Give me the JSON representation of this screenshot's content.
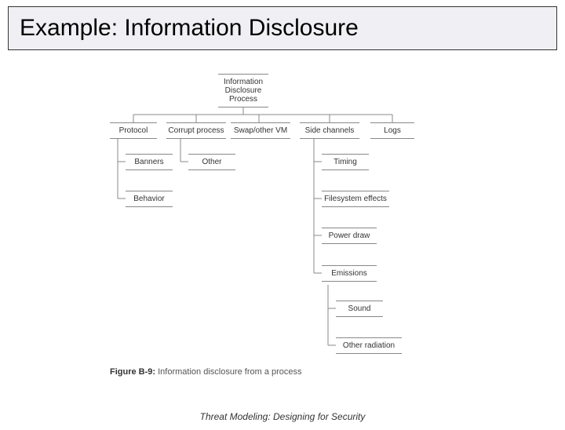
{
  "title": "Example: Information Disclosure",
  "footer": "Threat Modeling: Designing for Security",
  "caption_prefix": "Figure B-9:",
  "caption_text": " Information disclosure from a process",
  "nodes": {
    "root": "Information\nDisclosure\nProcess",
    "protocol": "Protocol",
    "corrupt": "Corrupt process",
    "swap": "Swap/other VM",
    "side": "Side channels",
    "logs": "Logs",
    "banners": "Banners",
    "behavior": "Behavior",
    "other": "Other",
    "timing": "Timing",
    "filesystem": "Filesystem effects",
    "power": "Power draw",
    "emissions": "Emissions",
    "sound": "Sound",
    "radiation": "Other radiation"
  }
}
